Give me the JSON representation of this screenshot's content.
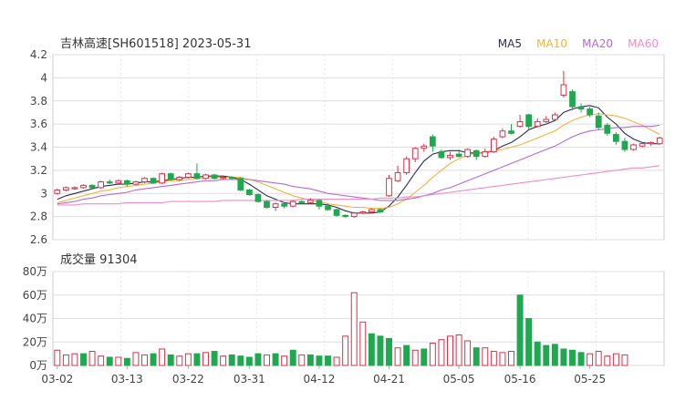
{
  "chart_data": [
    {
      "type": "candlestick",
      "title": "吉林高速[SH601518] 2023-05-31",
      "legend": [
        {
          "name": "MA5",
          "color": "#2b2b55"
        },
        {
          "name": "MA10",
          "color": "#f0b43c"
        },
        {
          "name": "MA20",
          "color": "#b46ad6"
        },
        {
          "name": "MA60",
          "color": "#f08cc8"
        }
      ],
      "legend_position": "top-right",
      "ylim": [
        2.6,
        4.2
      ],
      "yticks": [
        "4.2",
        "4",
        "3.8",
        "3.6",
        "3.4",
        "3.2",
        "3",
        "2.8",
        "2.6"
      ],
      "colors": {
        "up": "#d6334a",
        "down": "#1fa84f"
      },
      "candles": [
        [
          3.0,
          3.03,
          2.99,
          3.04
        ],
        [
          3.03,
          3.05,
          3.02,
          3.06
        ],
        [
          3.04,
          3.05,
          3.03,
          3.06
        ],
        [
          3.05,
          3.07,
          3.04,
          3.08
        ],
        [
          3.07,
          3.05,
          3.04,
          3.08
        ],
        [
          3.05,
          3.1,
          3.04,
          3.11
        ],
        [
          3.1,
          3.09,
          3.08,
          3.12
        ],
        [
          3.09,
          3.11,
          3.08,
          3.12
        ],
        [
          3.11,
          3.08,
          3.06,
          3.12
        ],
        [
          3.08,
          3.1,
          3.07,
          3.11
        ],
        [
          3.1,
          3.13,
          3.09,
          3.14
        ],
        [
          3.13,
          3.09,
          3.08,
          3.14
        ],
        [
          3.09,
          3.17,
          3.08,
          3.18
        ],
        [
          3.17,
          3.12,
          3.11,
          3.18
        ],
        [
          3.12,
          3.14,
          3.11,
          3.15
        ],
        [
          3.14,
          3.17,
          3.13,
          3.18
        ],
        [
          3.17,
          3.13,
          3.12,
          3.26
        ],
        [
          3.13,
          3.16,
          3.12,
          3.17
        ],
        [
          3.16,
          3.13,
          3.12,
          3.17
        ],
        [
          3.13,
          3.14,
          3.12,
          3.15
        ],
        [
          3.14,
          3.13,
          3.12,
          3.15
        ],
        [
          3.13,
          3.03,
          3.02,
          3.14
        ],
        [
          3.03,
          2.99,
          2.98,
          3.04
        ],
        [
          2.99,
          2.93,
          2.92,
          3.0
        ],
        [
          2.93,
          2.88,
          2.87,
          2.94
        ],
        [
          2.88,
          2.91,
          2.85,
          2.92
        ],
        [
          2.91,
          2.89,
          2.87,
          2.92
        ],
        [
          2.89,
          2.93,
          2.88,
          2.94
        ],
        [
          2.93,
          2.92,
          2.91,
          2.94
        ],
        [
          2.92,
          2.94,
          2.91,
          2.96
        ],
        [
          2.94,
          2.89,
          2.86,
          2.95
        ],
        [
          2.89,
          2.86,
          2.85,
          2.91
        ],
        [
          2.86,
          2.81,
          2.8,
          2.87
        ],
        [
          2.81,
          2.8,
          2.79,
          2.82
        ],
        [
          2.8,
          2.83,
          2.79,
          2.84
        ],
        [
          2.83,
          2.84,
          2.82,
          2.85
        ],
        [
          2.84,
          2.86,
          2.83,
          2.87
        ],
        [
          2.86,
          2.84,
          2.83,
          2.87
        ],
        [
          2.98,
          3.13,
          2.97,
          3.16
        ],
        [
          3.11,
          3.18,
          3.1,
          3.24
        ],
        [
          3.18,
          3.3,
          3.16,
          3.32
        ],
        [
          3.3,
          3.39,
          3.27,
          3.4
        ],
        [
          3.39,
          3.41,
          3.36,
          3.43
        ],
        [
          3.49,
          3.41,
          3.36,
          3.51
        ],
        [
          3.36,
          3.31,
          3.3,
          3.38
        ],
        [
          3.31,
          3.33,
          3.29,
          3.36
        ],
        [
          3.34,
          3.32,
          3.31,
          3.38
        ],
        [
          3.32,
          3.38,
          3.31,
          3.39
        ],
        [
          3.37,
          3.32,
          3.29,
          3.38
        ],
        [
          3.32,
          3.36,
          3.31,
          3.39
        ],
        [
          3.36,
          3.47,
          3.35,
          3.49
        ],
        [
          3.49,
          3.54,
          3.48,
          3.56
        ],
        [
          3.54,
          3.52,
          3.51,
          3.6
        ],
        [
          3.58,
          3.62,
          3.57,
          3.68
        ],
        [
          3.68,
          3.58,
          3.55,
          3.69
        ],
        [
          3.58,
          3.62,
          3.57,
          3.65
        ],
        [
          3.62,
          3.64,
          3.61,
          3.67
        ],
        [
          3.64,
          3.68,
          3.63,
          3.7
        ],
        [
          3.85,
          3.94,
          3.83,
          4.06
        ],
        [
          3.88,
          3.75,
          3.72,
          3.9
        ],
        [
          3.75,
          3.73,
          3.7,
          3.78
        ],
        [
          3.73,
          3.68,
          3.66,
          3.75
        ],
        [
          3.67,
          3.57,
          3.55,
          3.7
        ],
        [
          3.59,
          3.52,
          3.5,
          3.61
        ],
        [
          3.51,
          3.45,
          3.42,
          3.53
        ],
        [
          3.45,
          3.38,
          3.36,
          3.48
        ],
        [
          3.38,
          3.42,
          3.37,
          3.43
        ],
        [
          3.41,
          3.43,
          3.4,
          3.44
        ],
        [
          3.43,
          3.44,
          3.41,
          3.45
        ],
        [
          3.43,
          3.48,
          3.42,
          3.49
        ]
      ],
      "ma": {
        "MA5": [
          2.95,
          2.98,
          3.0,
          3.02,
          3.04,
          3.06,
          3.07,
          3.08,
          3.08,
          3.09,
          3.1,
          3.1,
          3.11,
          3.12,
          3.13,
          3.14,
          3.14,
          3.15,
          3.15,
          3.15,
          3.14,
          3.12,
          3.08,
          3.03,
          2.98,
          2.95,
          2.92,
          2.91,
          2.91,
          2.91,
          2.91,
          2.9,
          2.88,
          2.85,
          2.83,
          2.83,
          2.83,
          2.84,
          2.89,
          2.97,
          3.07,
          3.18,
          3.28,
          3.34,
          3.36,
          3.37,
          3.37,
          3.35,
          3.35,
          3.35,
          3.37,
          3.41,
          3.44,
          3.49,
          3.55,
          3.58,
          3.6,
          3.63,
          3.7,
          3.73,
          3.75,
          3.76,
          3.74,
          3.66,
          3.6,
          3.52,
          3.47,
          3.44,
          3.43,
          3.43
        ],
        "MA10": [
          2.92,
          2.94,
          2.96,
          2.98,
          3.0,
          3.02,
          3.03,
          3.05,
          3.06,
          3.07,
          3.08,
          3.09,
          3.1,
          3.11,
          3.11,
          3.12,
          3.13,
          3.13,
          3.14,
          3.14,
          3.14,
          3.14,
          3.12,
          3.1,
          3.07,
          3.04,
          3.01,
          2.98,
          2.96,
          2.94,
          2.93,
          2.91,
          2.9,
          2.89,
          2.88,
          2.88,
          2.87,
          2.87,
          2.88,
          2.91,
          2.95,
          3.01,
          3.07,
          3.14,
          3.2,
          3.26,
          3.3,
          3.33,
          3.35,
          3.36,
          3.37,
          3.38,
          3.4,
          3.42,
          3.45,
          3.48,
          3.51,
          3.54,
          3.59,
          3.63,
          3.66,
          3.68,
          3.69,
          3.68,
          3.67,
          3.65,
          3.62,
          3.59,
          3.55,
          3.51
        ],
        "MA20": [
          2.91,
          2.92,
          2.93,
          2.95,
          2.96,
          2.98,
          2.99,
          3.0,
          3.01,
          3.03,
          3.04,
          3.05,
          3.06,
          3.07,
          3.08,
          3.09,
          3.1,
          3.11,
          3.11,
          3.12,
          3.12,
          3.12,
          3.12,
          3.11,
          3.1,
          3.09,
          3.08,
          3.06,
          3.05,
          3.04,
          3.02,
          3.0,
          2.99,
          2.98,
          2.97,
          2.96,
          2.95,
          2.94,
          2.94,
          2.94,
          2.95,
          2.96,
          2.98,
          3.0,
          3.03,
          3.05,
          3.08,
          3.11,
          3.14,
          3.17,
          3.2,
          3.23,
          3.26,
          3.29,
          3.32,
          3.35,
          3.38,
          3.41,
          3.45,
          3.49,
          3.52,
          3.54,
          3.55,
          3.56,
          3.57,
          3.57,
          3.58,
          3.58,
          3.58,
          3.59
        ],
        "MA60": [
          2.9,
          2.9,
          2.9,
          2.91,
          2.91,
          2.91,
          2.91,
          2.91,
          2.92,
          2.92,
          2.92,
          2.92,
          2.92,
          2.93,
          2.93,
          2.93,
          2.93,
          2.93,
          2.93,
          2.94,
          2.94,
          2.94,
          2.94,
          2.94,
          2.94,
          2.94,
          2.94,
          2.94,
          2.95,
          2.95,
          2.95,
          2.95,
          2.95,
          2.95,
          2.95,
          2.95,
          2.95,
          2.96,
          2.96,
          2.96,
          2.97,
          2.97,
          2.98,
          2.99,
          3.0,
          3.01,
          3.02,
          3.03,
          3.04,
          3.05,
          3.06,
          3.07,
          3.08,
          3.09,
          3.1,
          3.11,
          3.12,
          3.13,
          3.14,
          3.15,
          3.16,
          3.17,
          3.18,
          3.19,
          3.2,
          3.21,
          3.22,
          3.22,
          3.23,
          3.24
        ]
      }
    },
    {
      "type": "bar",
      "title": "成交量 91304",
      "unit": "万",
      "ylim": [
        0,
        80
      ],
      "yticks": [
        "80万",
        "60万",
        "40万",
        "20万",
        "0万"
      ],
      "x_ticks": [
        {
          "index": 0,
          "label": "03-02"
        },
        {
          "index": 8,
          "label": "03-13"
        },
        {
          "index": 15,
          "label": "03-22"
        },
        {
          "index": 22,
          "label": "03-31"
        },
        {
          "index": 30,
          "label": "04-12"
        },
        {
          "index": 38,
          "label": "04-21"
        },
        {
          "index": 46,
          "label": "05-05"
        },
        {
          "index": 53,
          "label": "05-16"
        },
        {
          "index": 61,
          "label": "05-25"
        }
      ],
      "values": [
        13,
        9,
        10,
        10,
        12,
        8,
        7,
        7,
        6,
        11,
        9,
        10,
        14,
        9,
        8,
        10,
        10,
        11,
        12,
        8,
        9,
        8,
        7,
        10,
        9,
        10,
        8,
        13,
        9,
        9,
        8,
        8,
        7,
        25,
        62,
        37,
        27,
        25,
        23,
        15,
        17,
        13,
        14,
        19,
        22,
        25,
        26,
        21,
        15,
        15,
        12,
        11,
        12,
        60,
        40,
        20,
        17,
        18,
        14,
        13,
        11,
        10,
        12,
        8,
        10,
        9
      ],
      "up": [
        true,
        true,
        true,
        false,
        true,
        true,
        false,
        true,
        false,
        true,
        true,
        false,
        true,
        false,
        true,
        true,
        false,
        true,
        false,
        true,
        false,
        false,
        false,
        false,
        true,
        false,
        true,
        false,
        true,
        false,
        false,
        false,
        true,
        true,
        true,
        true,
        false,
        false,
        false,
        true,
        false,
        true,
        false,
        true,
        true,
        true,
        true,
        true,
        false,
        true,
        true,
        true,
        true,
        false,
        false,
        false,
        false,
        false,
        false,
        false,
        false,
        true,
        true,
        true,
        true,
        true
      ]
    }
  ]
}
